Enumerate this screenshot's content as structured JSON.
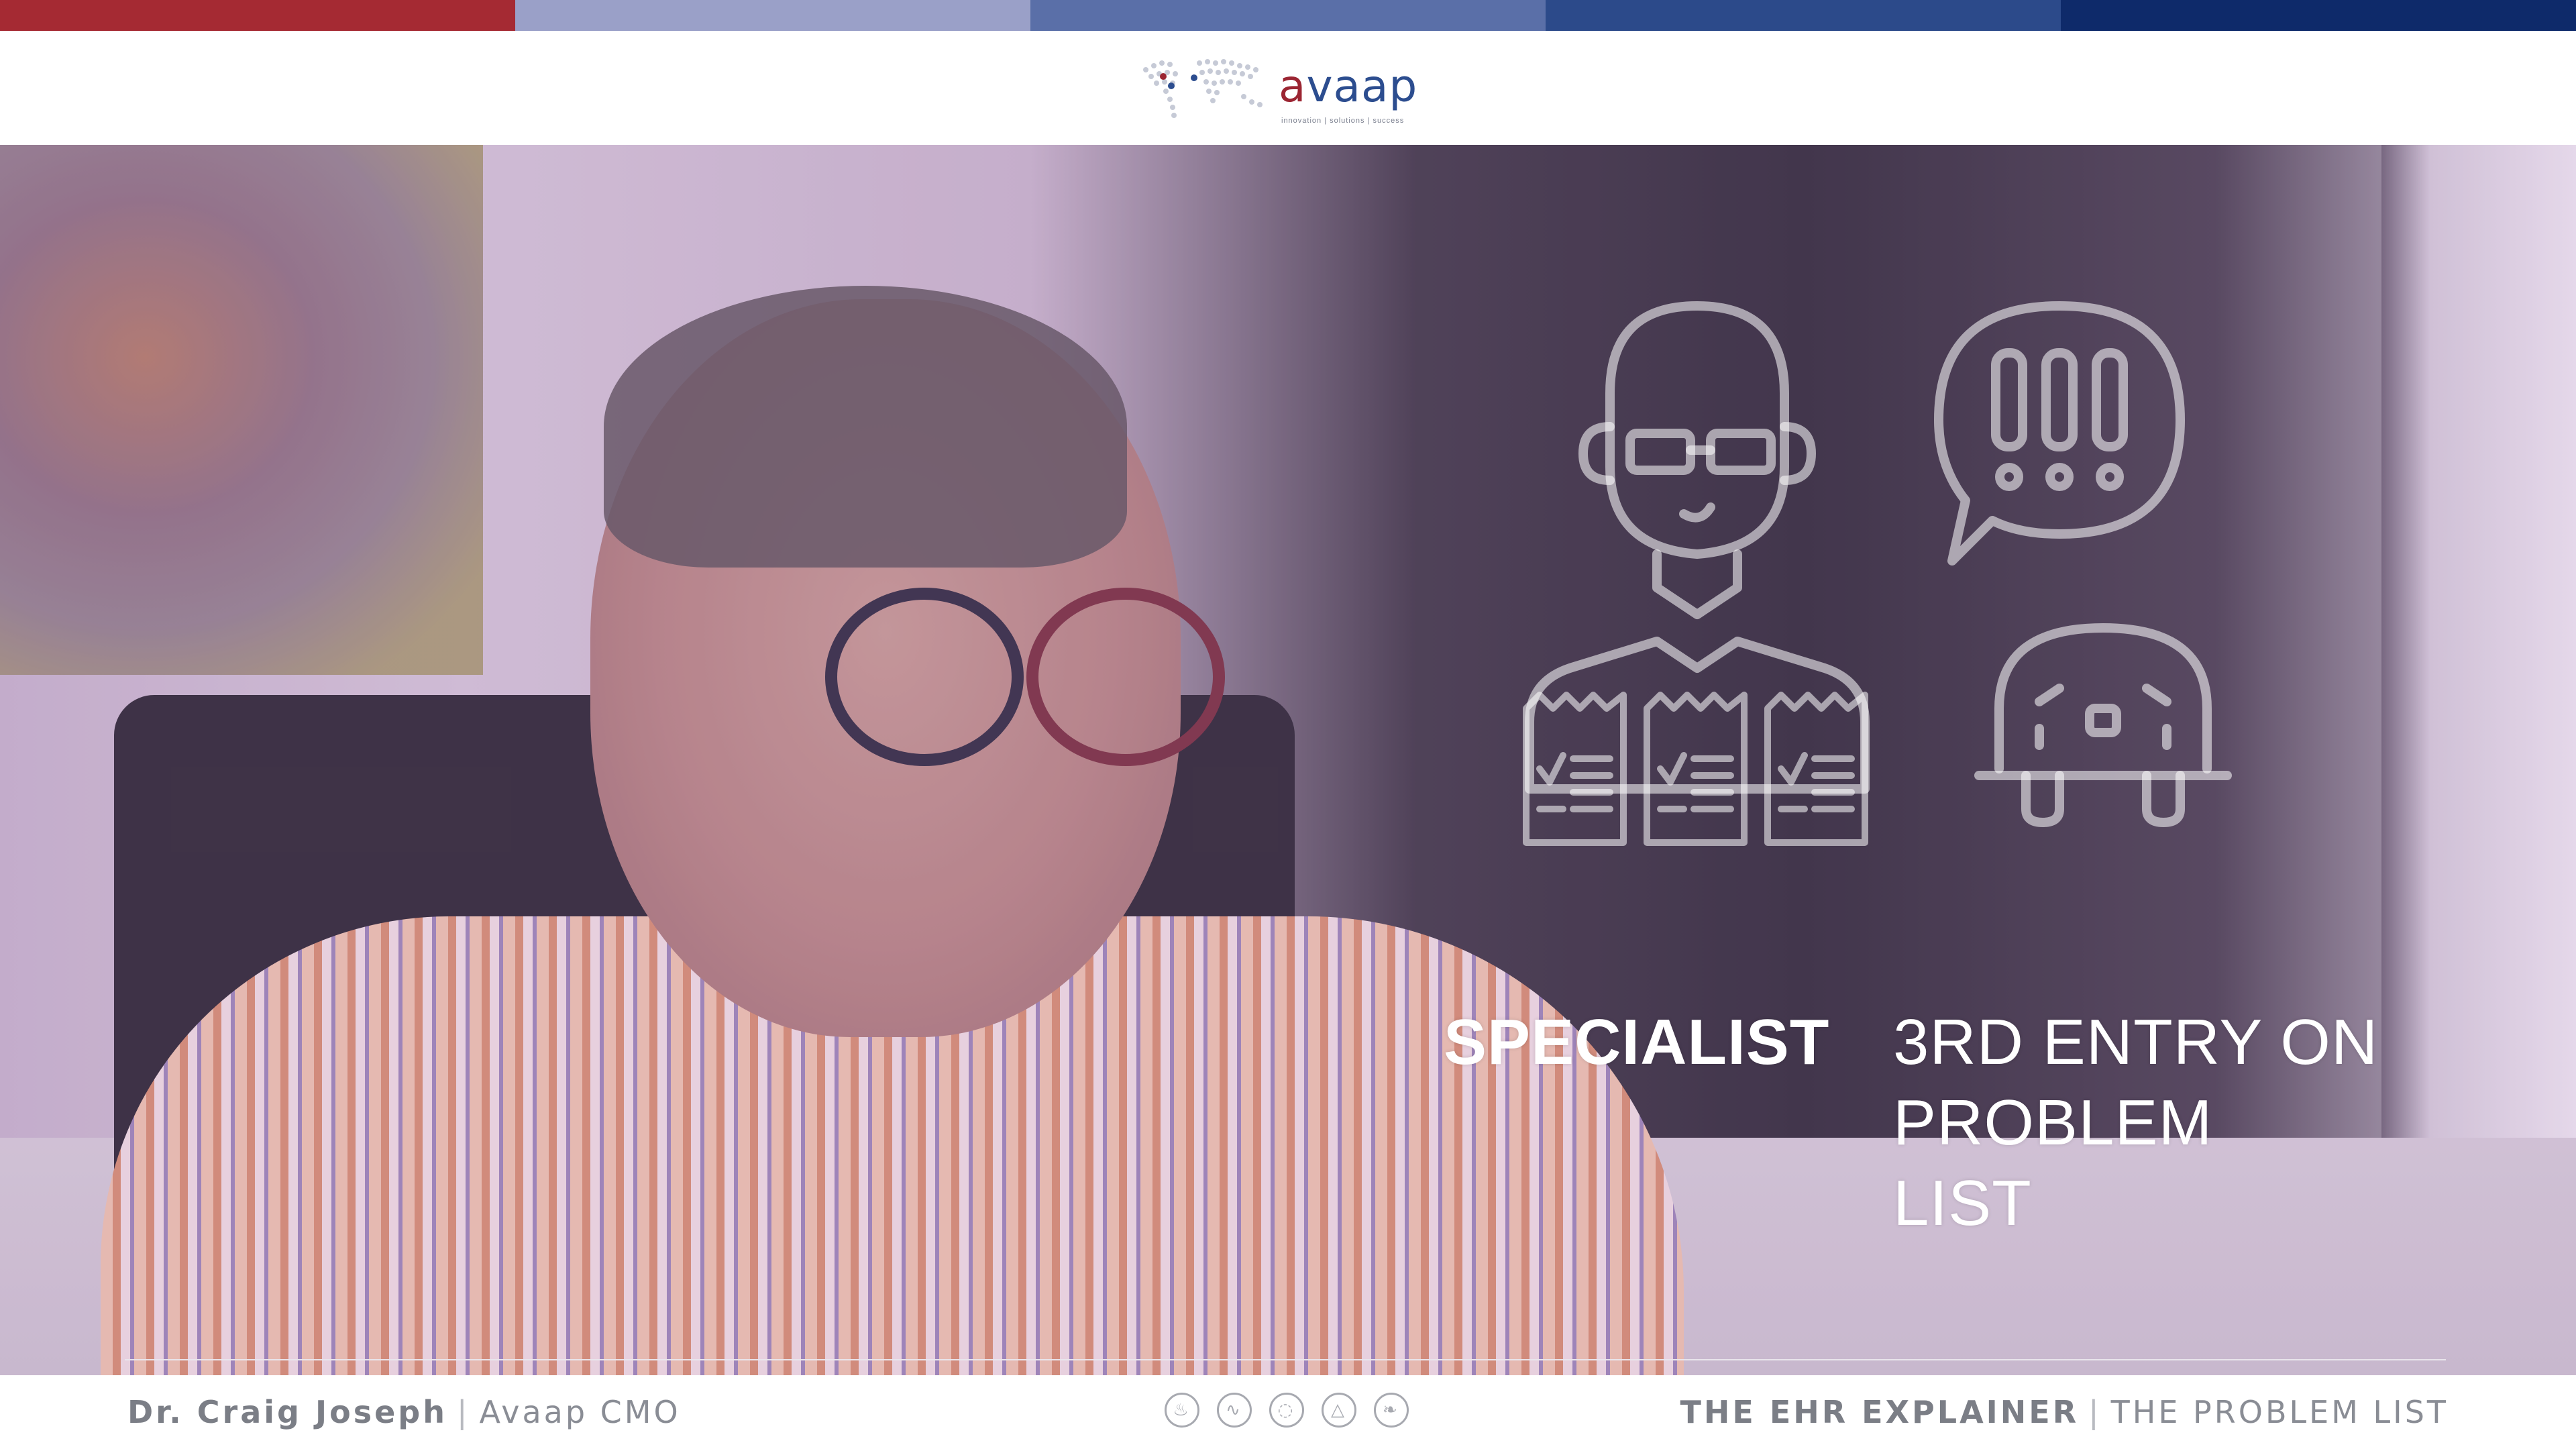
{
  "stripe_colors": [
    "#a52a33",
    "#9aa0c8",
    "#5a6fa8",
    "#2c4a8a",
    "#0e2a6a"
  ],
  "logo": {
    "word_a": "a",
    "word_rest": "vaap",
    "tagline": "innovation | solutions | success"
  },
  "overlay": {
    "specialist_label": "SPECIALIST",
    "entry_lines": [
      "3RD ENTRY ON",
      "PROBLEM",
      "LIST"
    ],
    "icons": [
      "specialist-person-icon",
      "notepad-icon",
      "notepad-icon",
      "notepad-icon",
      "exclamation-speech-bubble-icon",
      "sad-creature-icon"
    ]
  },
  "footer": {
    "name": "Dr. Craig Joseph",
    "role": "Avaap CMO",
    "series": "THE EHR EXPLAINER",
    "episode": "THE PROBLEM LIST",
    "icons": [
      "flame-icon",
      "swirl-icon",
      "circle-swirl-icon",
      "drop-icon",
      "leaf-icon"
    ]
  }
}
